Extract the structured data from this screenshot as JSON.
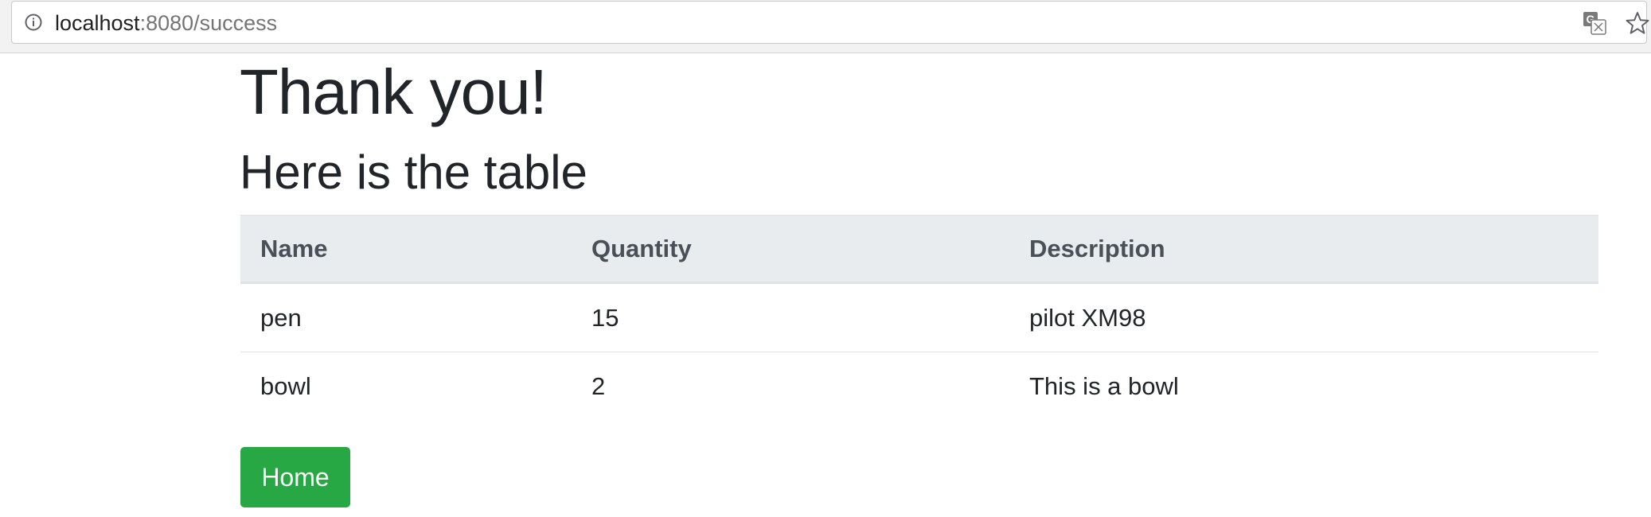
{
  "browser": {
    "url_host": "localhost",
    "url_path": ":8080/success",
    "icons": [
      "info-icon",
      "translate-icon",
      "star-icon"
    ]
  },
  "page": {
    "heading": "Thank you!",
    "subheading": "Here is the table"
  },
  "table": {
    "headers": [
      "Name",
      "Quantity",
      "Description"
    ],
    "rows": [
      [
        "pen",
        "15",
        "pilot XM98"
      ],
      [
        "bowl",
        "2",
        "This is a bowl"
      ]
    ]
  },
  "actions": {
    "home_label": "Home",
    "home_color": "#28a745"
  },
  "colors": {
    "header_bg": "#e9ecef",
    "text": "#212529"
  }
}
